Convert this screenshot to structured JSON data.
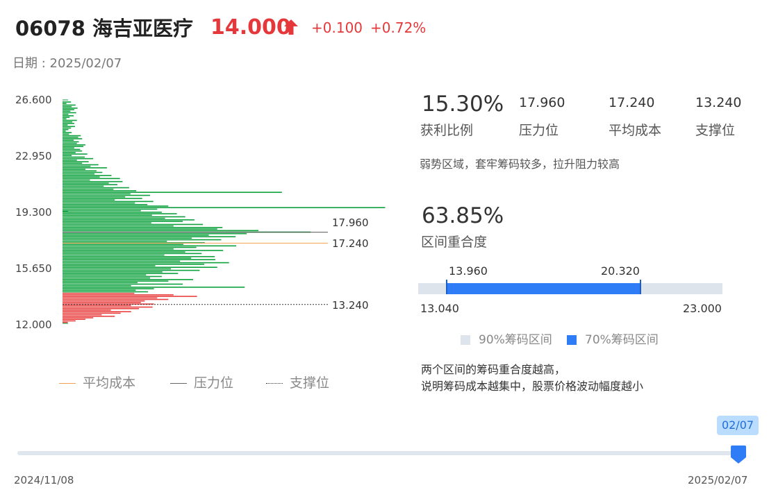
{
  "header": {
    "code_name": "06078 海吉亚医疗",
    "price": "14.000",
    "change": "+0.100",
    "change_pct": "+0.72%",
    "up_color": "#e5383b",
    "date": "日期 : 2025/02/07"
  },
  "chart_data": {
    "type": "bar",
    "orientation": "horizontal",
    "y_ticks": [
      "26.600",
      "22.950",
      "19.300",
      "15.650",
      "12.000"
    ],
    "ylim": [
      12.0,
      26.6
    ],
    "current_price": 14.0,
    "colors": {
      "profit": "#e94040",
      "loss": "#0ea13e"
    },
    "series": [
      {
        "name": "筹码分布",
        "points": [
          [
            26.45,
            0.13
          ],
          [
            26.35,
            0.06
          ],
          [
            26.25,
            0.2
          ],
          [
            26.15,
            0.14
          ],
          [
            26.05,
            0.23
          ],
          [
            25.95,
            0.18
          ],
          [
            25.85,
            0.12
          ],
          [
            25.75,
            0.21
          ],
          [
            25.65,
            0.09
          ],
          [
            25.55,
            0.17
          ],
          [
            25.45,
            0.11
          ],
          [
            25.35,
            0.06
          ],
          [
            25.25,
            0.22
          ],
          [
            25.15,
            0.15
          ],
          [
            25.05,
            0.18
          ],
          [
            24.95,
            0.08
          ],
          [
            24.85,
            0.19
          ],
          [
            24.75,
            0.13
          ],
          [
            24.65,
            0.09
          ],
          [
            24.55,
            0.05
          ],
          [
            24.45,
            0.14
          ],
          [
            24.35,
            0.1
          ],
          [
            24.25,
            0.28
          ],
          [
            24.15,
            0.24
          ],
          [
            24.05,
            0.3
          ],
          [
            23.95,
            0.17
          ],
          [
            23.85,
            0.25
          ],
          [
            23.75,
            0.22
          ],
          [
            23.65,
            0.35
          ],
          [
            23.55,
            0.32
          ],
          [
            23.45,
            0.18
          ],
          [
            23.35,
            0.27
          ],
          [
            23.25,
            0.3
          ],
          [
            23.15,
            0.2
          ],
          [
            23.05,
            0.38
          ],
          [
            22.95,
            0.14
          ],
          [
            22.85,
            0.34
          ],
          [
            22.75,
            0.47
          ],
          [
            22.65,
            0.22
          ],
          [
            22.55,
            0.4
          ],
          [
            22.45,
            0.3
          ],
          [
            22.35,
            0.55
          ],
          [
            22.25,
            0.43
          ],
          [
            22.15,
            0.68
          ],
          [
            22.05,
            0.35
          ],
          [
            21.95,
            0.52
          ],
          [
            21.85,
            0.61
          ],
          [
            21.75,
            0.49
          ],
          [
            21.65,
            0.75
          ],
          [
            21.55,
            0.57
          ],
          [
            21.45,
            0.88
          ],
          [
            21.35,
            0.42
          ],
          [
            21.25,
            0.92
          ],
          [
            21.15,
            0.71
          ],
          [
            21.05,
            0.84
          ],
          [
            20.95,
            0.63
          ],
          [
            20.85,
            1.02
          ],
          [
            20.75,
            0.78
          ],
          [
            20.65,
            1.13
          ],
          [
            20.55,
            3.36
          ],
          [
            20.45,
            1.04
          ],
          [
            20.35,
            1.34
          ],
          [
            20.25,
            0.96
          ],
          [
            20.15,
            1.22
          ],
          [
            20.05,
            0.8
          ],
          [
            19.95,
            1.39
          ],
          [
            19.85,
            1.11
          ],
          [
            19.75,
            1.3
          ],
          [
            19.65,
            1.62
          ],
          [
            19.55,
            4.94
          ],
          [
            19.45,
            1.45
          ],
          [
            19.35,
            1.2
          ],
          [
            19.25,
            1.52
          ],
          [
            19.15,
            1.75
          ],
          [
            19.05,
            1.37
          ],
          [
            18.95,
            1.88
          ],
          [
            18.85,
            1.57
          ],
          [
            18.75,
            2.02
          ],
          [
            18.65,
            1.84
          ],
          [
            18.55,
            1.36
          ],
          [
            18.45,
            2.15
          ],
          [
            18.35,
            1.7
          ],
          [
            18.25,
            2.45
          ],
          [
            18.15,
            2.37
          ],
          [
            18.05,
            3.0
          ],
          [
            17.95,
            3.8
          ],
          [
            17.85,
            2.82
          ],
          [
            17.75,
            2.24
          ],
          [
            17.65,
            2.65
          ],
          [
            17.55,
            1.98
          ],
          [
            17.45,
            2.43
          ],
          [
            17.35,
            1.6
          ],
          [
            17.25,
            2.18
          ],
          [
            17.15,
            1.85
          ],
          [
            17.05,
            2.66
          ],
          [
            16.95,
            2.05
          ],
          [
            16.85,
            1.7
          ],
          [
            16.75,
            2.46
          ],
          [
            16.65,
            1.88
          ],
          [
            16.55,
            2.13
          ],
          [
            16.45,
            1.56
          ],
          [
            16.35,
            2.33
          ],
          [
            16.25,
            1.97
          ],
          [
            16.15,
            2.34
          ],
          [
            16.05,
            1.8
          ],
          [
            15.95,
            2.55
          ],
          [
            15.85,
            2.17
          ],
          [
            15.75,
            1.42
          ],
          [
            15.65,
            2.37
          ],
          [
            15.55,
            1.66
          ],
          [
            15.45,
            2.1
          ],
          [
            15.35,
            1.53
          ],
          [
            15.25,
            1.77
          ],
          [
            15.15,
            1.28
          ],
          [
            15.05,
            1.52
          ],
          [
            14.95,
            1.34
          ],
          [
            14.85,
            2.0
          ],
          [
            14.75,
            1.62
          ],
          [
            14.65,
            1.15
          ],
          [
            14.55,
            1.84
          ],
          [
            14.45,
            1.05
          ],
          [
            14.35,
            2.79
          ],
          [
            14.25,
            1.4
          ],
          [
            14.15,
            1.12
          ],
          [
            14.05,
            1.31
          ],
          [
            13.95,
            1.1
          ],
          [
            13.85,
            1.7
          ],
          [
            13.75,
            2.06
          ],
          [
            13.65,
            1.45
          ],
          [
            13.55,
            1.62
          ],
          [
            13.45,
            1.26
          ],
          [
            13.35,
            1.2
          ],
          [
            13.25,
            1.4
          ],
          [
            13.15,
            1.05
          ],
          [
            13.05,
            1.38
          ],
          [
            12.95,
            1.17
          ],
          [
            12.85,
            0.74
          ],
          [
            12.75,
            1.05
          ],
          [
            12.65,
            0.89
          ],
          [
            12.55,
            0.6
          ],
          [
            12.45,
            0.8
          ],
          [
            12.35,
            0.47
          ],
          [
            12.25,
            0.35
          ],
          [
            12.15,
            0.2
          ],
          [
            12.05,
            0.08
          ]
        ]
      }
    ],
    "levels": [
      {
        "name": "压力位",
        "value": "17.960",
        "color": "#555555",
        "style": "solid"
      },
      {
        "name": "平均成本",
        "value": "17.240",
        "color": "#f0a050",
        "style": "solid"
      },
      {
        "name": "支撑位",
        "value": "13.240",
        "color": "#333333",
        "style": "dotted"
      }
    ],
    "legend": [
      "平均成本",
      "压力位",
      "支撑位"
    ]
  },
  "stats": {
    "profit_ratio": "15.30%",
    "profit_ratio_label": "获利比例",
    "pressure": "17.960",
    "pressure_label": "压力位",
    "avg_cost": "17.240",
    "avg_cost_label": "平均成本",
    "support": "13.240",
    "support_label": "支撑位",
    "desc": "弱势区域，套牢筹码较多，拉升阻力较高"
  },
  "overlap": {
    "value": "63.85%",
    "label": "区间重合度",
    "range90": {
      "low": 13.04,
      "high": 23.0,
      "low_text": "13.040",
      "high_text": "23.000",
      "label": "90%筹码区间",
      "color": "#dde4ec"
    },
    "range70": {
      "low": 13.96,
      "high": 20.32,
      "low_text": "13.960",
      "high_text": "20.320",
      "label": "70%筹码区间",
      "color": "#2e7cf6"
    },
    "note1": "两个区间的筹码重合度越高，",
    "note2": "说明筹码成本越集中，股票价格波动幅度越小"
  },
  "slider": {
    "start": "2024/11/08",
    "end": "2025/02/07",
    "current": "02/07",
    "position": 1.0
  }
}
